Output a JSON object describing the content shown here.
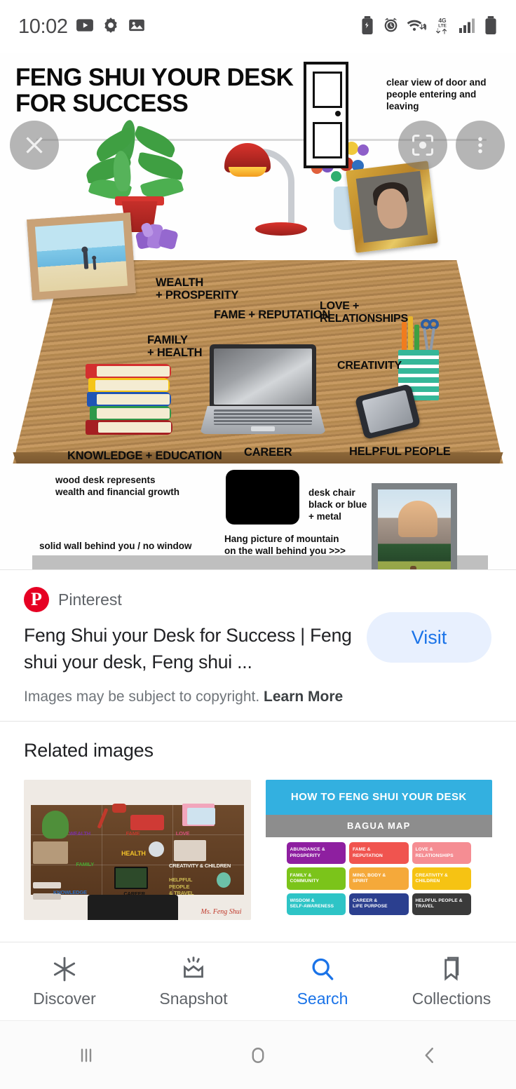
{
  "status_bar": {
    "time": "10:02",
    "left_icons": [
      "youtube-icon",
      "settings-gear-icon",
      "photos-icon"
    ],
    "right_icons": [
      "battery-saver-icon",
      "alarm-icon",
      "wifi-icon",
      "4g-lte-icon",
      "signal-bars-icon",
      "battery-icon"
    ],
    "network": "4G LTE"
  },
  "viewer": {
    "close_label": "✕",
    "lens_label": "lens",
    "more_label": "more",
    "infographic": {
      "title": "FENG SHUI YOUR DESK FOR SUCCESS",
      "door_note": "clear view of door and people entering and leaving",
      "zones": [
        {
          "label": "WEALTH\n+ PROSPERITY",
          "name": "wealth-prosperity"
        },
        {
          "label": "FAME + REPUTATION",
          "name": "fame-reputation"
        },
        {
          "label": "LOVE +\nRELATIONSHIPS",
          "name": "love-relationships"
        },
        {
          "label": "FAMILY\n+ HEALTH",
          "name": "family-health"
        },
        {
          "label": "CREATIVITY",
          "name": "creativity"
        },
        {
          "label": "KNOWLEDGE + EDUCATION",
          "name": "knowledge-education"
        },
        {
          "label": "CAREER",
          "name": "career"
        },
        {
          "label": "HELPFUL PEOPLE",
          "name": "helpful-people"
        }
      ],
      "notes": {
        "wood_desk": "wood desk represents\nwealth and financial growth",
        "solid_wall": "solid wall behind you / no window",
        "desk_chair": "desk chair\nblack or blue\n+ metal",
        "hang_picture": "Hang picture of mountain\non the wall behind you >>>"
      }
    }
  },
  "attribution": {
    "source": "Pinterest",
    "title": "Feng Shui your Desk for Success | Feng shui your desk, Feng shui ...",
    "copyright_text": "Images may be subject to copyright.",
    "learn_more": "Learn More",
    "visit_label": "Visit",
    "visit_color": "#1a73e8"
  },
  "related": {
    "heading": "Related images",
    "thumbnails": [
      {
        "name": "related-thumb-desk-bagua",
        "labels": [
          "WEALTH",
          "FAME",
          "LOVE",
          "FAMILY",
          "HEALTH",
          "CREATIVITY  & CHILDREN",
          "KNOWLEDGE",
          "CAREER",
          "HELPFUL\nPEOPLE\n& TRAVEL"
        ],
        "watermark": "Ms. Feng Shui"
      },
      {
        "name": "related-thumb-how-to",
        "header": "HOW TO FENG SHUI YOUR DESK",
        "subheader": "BAGUA MAP",
        "cells": [
          {
            "text": "ABUNDANCE &\nPROSPERITY",
            "color": "#8e1fa0"
          },
          {
            "text": "FAME &\nREPUTATION",
            "color": "#f0544f"
          },
          {
            "text": "LOVE &\nRELATIONSHIPS",
            "color": "#f58d93"
          },
          {
            "text": "FAMILY &\nCOMMUNITY",
            "color": "#7bc41a"
          },
          {
            "text": "MIND, BODY &\nSPIRIT",
            "color": "#f5a93a"
          },
          {
            "text": "CREATIVITY &\nCHILDREN",
            "color": "#f6c313"
          },
          {
            "text": "WISDOM &\nSELF-AWARENESS",
            "color": "#2ec4c6"
          },
          {
            "text": "CAREER &\nLIFE PURPOSE",
            "color": "#2b3f8f"
          },
          {
            "text": "HELPFUL PEOPLE &\nTRAVEL",
            "color": "#3a3a3a"
          }
        ]
      }
    ]
  },
  "app_nav": {
    "items": [
      {
        "label": "Discover",
        "icon": "asterisk-icon",
        "active": false
      },
      {
        "label": "Snapshot",
        "icon": "snapshot-icon",
        "active": false
      },
      {
        "label": "Search",
        "icon": "search-icon",
        "active": true
      },
      {
        "label": "Collections",
        "icon": "bookmark-icon",
        "active": false
      }
    ],
    "active_color": "#1a73e8",
    "inactive_color": "#5f6368"
  },
  "system_nav": {
    "recents_label": "recents",
    "home_label": "home",
    "back_label": "back"
  }
}
